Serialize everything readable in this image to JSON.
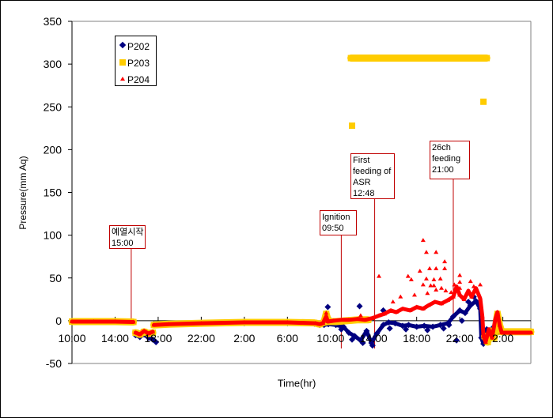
{
  "chart_data": {
    "type": "scatter",
    "title": "",
    "xlabel": "Time(hr)",
    "ylabel": "Pressure(mm Aq)",
    "x_unit": "hours elapsed from first 10:00",
    "xlim": [
      0,
      42.6
    ],
    "ylim": [
      -50,
      350
    ],
    "grid": false,
    "legend_position": "top-left",
    "y_ticks": [
      -50,
      0,
      50,
      100,
      150,
      200,
      250,
      300,
      350
    ],
    "x_ticks": [
      {
        "x": 0,
        "label": "10:00"
      },
      {
        "x": 4,
        "label": "14:00"
      },
      {
        "x": 8,
        "label": "18:00"
      },
      {
        "x": 12,
        "label": "22:00"
      },
      {
        "x": 16,
        "label": "2:00"
      },
      {
        "x": 20,
        "label": "6:00"
      },
      {
        "x": 24,
        "label": "10:00"
      },
      {
        "x": 28,
        "label": "14:00"
      },
      {
        "x": 32,
        "label": "18:00"
      },
      {
        "x": 36,
        "label": "22:00"
      },
      {
        "x": 40,
        "label": "2:00"
      }
    ],
    "series": [
      {
        "name": "P202",
        "color": "#000080",
        "marker": "diamond",
        "segments": [
          [
            [
              0,
              -1.5
            ],
            [
              2,
              -1.5
            ],
            [
              4,
              -1.5
            ],
            [
              5.7,
              -2
            ]
          ],
          [
            [
              5.9,
              -17
            ],
            [
              6.3,
              -19
            ],
            [
              6.7,
              -16
            ],
            [
              7.1,
              -20
            ],
            [
              7.5,
              -22
            ],
            [
              7.8,
              -25
            ]
          ],
          [
            [
              7.6,
              -4
            ],
            [
              9,
              -4
            ],
            [
              12,
              -3.5
            ],
            [
              16,
              -3
            ],
            [
              20,
              -3
            ],
            [
              22.5,
              -3.5
            ],
            [
              23.0,
              -5
            ],
            [
              23.4,
              -5
            ],
            [
              23.8,
              -4
            ],
            [
              24.5,
              -5
            ],
            [
              25.2,
              -7
            ],
            [
              25.7,
              -14
            ],
            [
              26.25,
              -18
            ],
            [
              26.8,
              -23
            ],
            [
              27.35,
              -12
            ],
            [
              27.8,
              -26
            ],
            [
              28.3,
              -15
            ],
            [
              28.9,
              -5
            ],
            [
              29.4,
              -2
            ],
            [
              30.0,
              -3
            ],
            [
              30.7,
              -6
            ],
            [
              31.25,
              -5
            ],
            [
              32.0,
              -7
            ],
            [
              32.7,
              -6
            ],
            [
              33.5,
              -7
            ],
            [
              34.2,
              -5
            ],
            [
              34.9,
              -3
            ],
            [
              35.4,
              5
            ],
            [
              36.0,
              12
            ],
            [
              36.5,
              9
            ],
            [
              37.0,
              18
            ],
            [
              37.5,
              23
            ],
            [
              37.9,
              14
            ],
            [
              38.0,
              -20
            ],
            [
              38.2,
              -27
            ],
            [
              38.5,
              -10
            ],
            [
              38.8,
              -22
            ],
            [
              39.1,
              -8
            ],
            [
              39.4,
              -15
            ],
            [
              39.7,
              -12
            ],
            [
              40.2,
              -13.5
            ],
            [
              42.6,
              -13.5
            ]
          ]
        ],
        "points": [
          [
            23.75,
            16
          ],
          [
            26.7,
            17
          ],
          [
            28.9,
            12
          ],
          [
            27.9,
            -29
          ],
          [
            35.7,
            -23
          ],
          [
            26.0,
            -22
          ],
          [
            27.0,
            -26
          ],
          [
            29.5,
            -9
          ],
          [
            31.0,
            -10
          ],
          [
            33.0,
            -11
          ],
          [
            34.5,
            -9
          ],
          [
            36.2,
            0
          ],
          [
            36.8,
            22
          ],
          [
            37.3,
            28
          ],
          [
            35.0,
            -5
          ],
          [
            25.0,
            -10
          ]
        ]
      },
      {
        "name": "P203",
        "color": "#FFCC00",
        "marker": "square",
        "segments": [
          [
            [
              0,
              -1
            ],
            [
              2,
              -1
            ],
            [
              4,
              -1
            ],
            [
              5.7,
              -1.5
            ]
          ],
          [
            [
              5.9,
              -14
            ],
            [
              6.3,
              -16
            ],
            [
              6.7,
              -13
            ],
            [
              7.1,
              -15
            ],
            [
              7.5,
              -14
            ]
          ],
          [
            [
              7.6,
              -5
            ],
            [
              9,
              -4
            ],
            [
              12,
              -3
            ],
            [
              16,
              -2
            ],
            [
              20,
              -2
            ],
            [
              22.5,
              -2.5
            ],
            [
              23.0,
              -4
            ],
            [
              23.4,
              -2
            ],
            [
              23.6,
              8
            ],
            [
              23.8,
              -1
            ],
            [
              24.5,
              -1
            ],
            [
              25.5,
              0
            ],
            [
              26.5,
              1
            ],
            [
              27.5,
              1
            ]
          ],
          [
            [
              25.9,
              307
            ],
            [
              38.5,
              307
            ]
          ],
          [
            [
              38.3,
              -18
            ],
            [
              38.6,
              -25
            ],
            [
              38.9,
              -12
            ],
            [
              39.2,
              -20
            ],
            [
              39.5,
              8
            ],
            [
              39.7,
              -5
            ],
            [
              39.9,
              -13
            ],
            [
              42.6,
              -13
            ]
          ]
        ],
        "points": [
          [
            26.0,
            228
          ],
          [
            38.2,
            256
          ]
        ]
      },
      {
        "name": "P204",
        "color": "#FF0000",
        "marker": "triangle",
        "segments": [
          [
            [
              0,
              -1
            ],
            [
              2,
              -1
            ],
            [
              4,
              -1
            ],
            [
              5.7,
              -1.5
            ]
          ],
          [
            [
              5.9,
              -14
            ],
            [
              6.3,
              -16
            ],
            [
              6.7,
              -12
            ],
            [
              7.1,
              -15
            ],
            [
              7.5,
              -13
            ]
          ],
          [
            [
              7.6,
              -5
            ],
            [
              9,
              -4
            ],
            [
              12,
              -3
            ],
            [
              16,
              -2
            ],
            [
              20,
              -2
            ],
            [
              22.6,
              -3
            ],
            [
              23.0,
              -4
            ],
            [
              23.3,
              -3
            ],
            [
              23.6,
              5
            ],
            [
              23.75,
              -1
            ],
            [
              24.3,
              0
            ],
            [
              25.0,
              1
            ],
            [
              25.7,
              1
            ],
            [
              26.5,
              2
            ],
            [
              27.2,
              1
            ],
            [
              27.9,
              3
            ],
            [
              28.5,
              6
            ],
            [
              29.0,
              8
            ],
            [
              29.6,
              12
            ],
            [
              30.1,
              10
            ],
            [
              30.7,
              14
            ],
            [
              31.4,
              12
            ],
            [
              32.0,
              16
            ],
            [
              32.6,
              14
            ],
            [
              33.1,
              18
            ],
            [
              33.7,
              22
            ],
            [
              34.3,
              20
            ],
            [
              34.9,
              24
            ],
            [
              35.4,
              28
            ],
            [
              35.7,
              40
            ],
            [
              36.0,
              30
            ],
            [
              36.4,
              25
            ],
            [
              36.8,
              35
            ],
            [
              37.1,
              28
            ],
            [
              37.5,
              38
            ],
            [
              37.9,
              26
            ],
            [
              38.1,
              5
            ],
            [
              38.2,
              -18
            ],
            [
              38.4,
              -25
            ],
            [
              38.7,
              -10
            ],
            [
              39.0,
              -20
            ],
            [
              39.3,
              2
            ],
            [
              39.5,
              10
            ],
            [
              39.7,
              -5
            ],
            [
              39.9,
              -14
            ],
            [
              42.6,
              -14
            ]
          ]
        ],
        "points": [
          [
            32.6,
            94
          ],
          [
            32.9,
            80
          ],
          [
            33.8,
            80
          ],
          [
            34.6,
            69
          ],
          [
            34.6,
            61
          ],
          [
            32.3,
            58
          ],
          [
            33.2,
            61
          ],
          [
            33.8,
            61
          ],
          [
            28.5,
            52
          ],
          [
            31.2,
            52
          ],
          [
            31.5,
            48
          ],
          [
            32.9,
            49
          ],
          [
            33.6,
            48
          ],
          [
            34.2,
            49
          ],
          [
            32.6,
            42
          ],
          [
            33.3,
            41
          ],
          [
            33.6,
            41
          ],
          [
            33.0,
            32
          ],
          [
            33.8,
            36
          ],
          [
            34.3,
            38
          ],
          [
            34.7,
            35
          ],
          [
            36.0,
            53
          ],
          [
            36.0,
            45
          ],
          [
            36.0,
            38
          ],
          [
            37.0,
            46
          ],
          [
            37.3,
            40
          ],
          [
            37.9,
            42
          ],
          [
            37.6,
            35
          ],
          [
            30.5,
            28
          ],
          [
            31.8,
            30
          ],
          [
            29.8,
            22
          ],
          [
            35.2,
            33
          ],
          [
            35.5,
            42
          ],
          [
            36.6,
            31
          ],
          [
            23.6,
            9
          ],
          [
            26.8,
            6
          ]
        ]
      }
    ],
    "annotations": [
      {
        "lines": [
          "예열시작",
          "15:00"
        ],
        "x": 5.5
      },
      {
        "lines": [
          "Ignition",
          "09:50"
        ],
        "x": 25.0
      },
      {
        "lines": [
          "First",
          "feeding of",
          "ASR",
          "12:48"
        ],
        "x": 28.1
      },
      {
        "lines": [
          "26ch",
          "feeding",
          "21:00"
        ],
        "x": 35.4
      }
    ]
  }
}
